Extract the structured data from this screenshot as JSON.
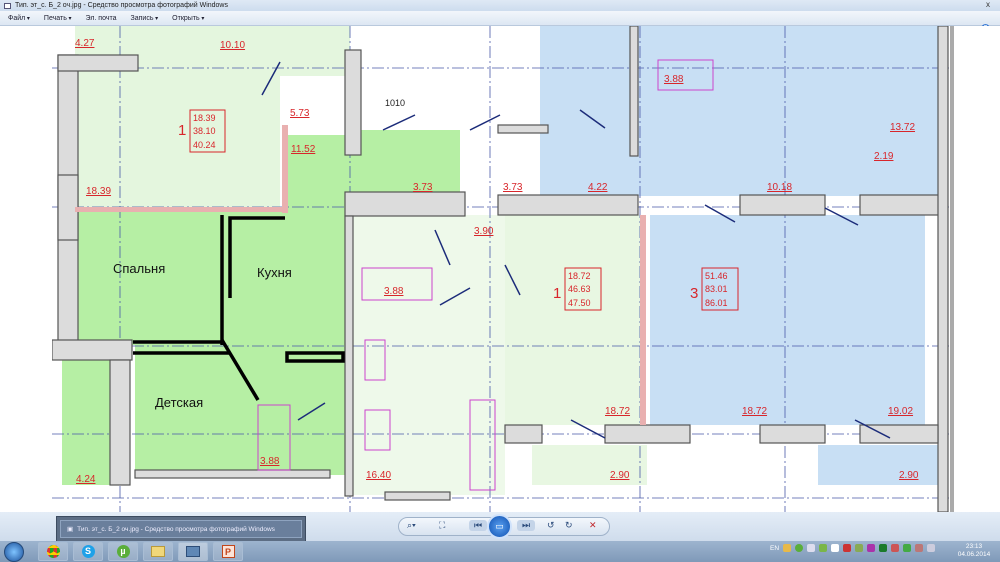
{
  "window": {
    "title": "Тип. эт_с. Б_2 оч.jpg - Средство просмотра фотографий Windows",
    "close": "x"
  },
  "menu": {
    "items": [
      "Файл",
      "Печать",
      "Эл. почта",
      "Запись",
      "Открыть"
    ],
    "help": "?"
  },
  "plan": {
    "room_labels": {
      "bedroom": "Спальня",
      "kitchen": "Кухня",
      "kids": "Детская"
    },
    "areas": [
      "4.27",
      "10.10",
      "5.73",
      "11.52",
      "18.39",
      "3.73",
      "3.73",
      "4.22",
      "3.90",
      "3.88",
      "13.72",
      "2.19",
      "10.18",
      "3.88",
      "18.72",
      "18.72",
      "19.02",
      "4.24",
      "3.88",
      "16.40",
      "2.90",
      "2.90"
    ],
    "dimension": "1010",
    "apartments": [
      {
        "rooms": "1",
        "values": [
          "18.39",
          "38.10",
          "40.24"
        ]
      },
      {
        "rooms": "1",
        "values": [
          "18.72",
          "46.63",
          "47.50"
        ]
      },
      {
        "rooms": "3",
        "values": [
          "51.46",
          "83.01",
          "86.01"
        ]
      }
    ],
    "colors": {
      "green_light": "#e4f6de",
      "green_bright": "#b6efa4",
      "blue": "#c8dff4",
      "wall": "#d9d9d9",
      "label": "#d8262b"
    }
  },
  "controls": {
    "preview_title": "Тип. эт_с. Б_2 оч.jpg - Средство просмотра фотографий Windows",
    "zoom": "⌕▾",
    "fit": "⛶",
    "prev": "⏮",
    "slideshow": "▭",
    "next": "⏭",
    "rotate_ccw": "↺",
    "rotate_cw": "↻",
    "delete": "✕"
  },
  "taskbar": {
    "apps": [
      "Chrome",
      "S",
      "µ",
      "Explorer",
      "Photo Viewer",
      "P"
    ]
  },
  "tray": {
    "lang": "EN",
    "time": "23:13",
    "date": "04.06.2014"
  }
}
